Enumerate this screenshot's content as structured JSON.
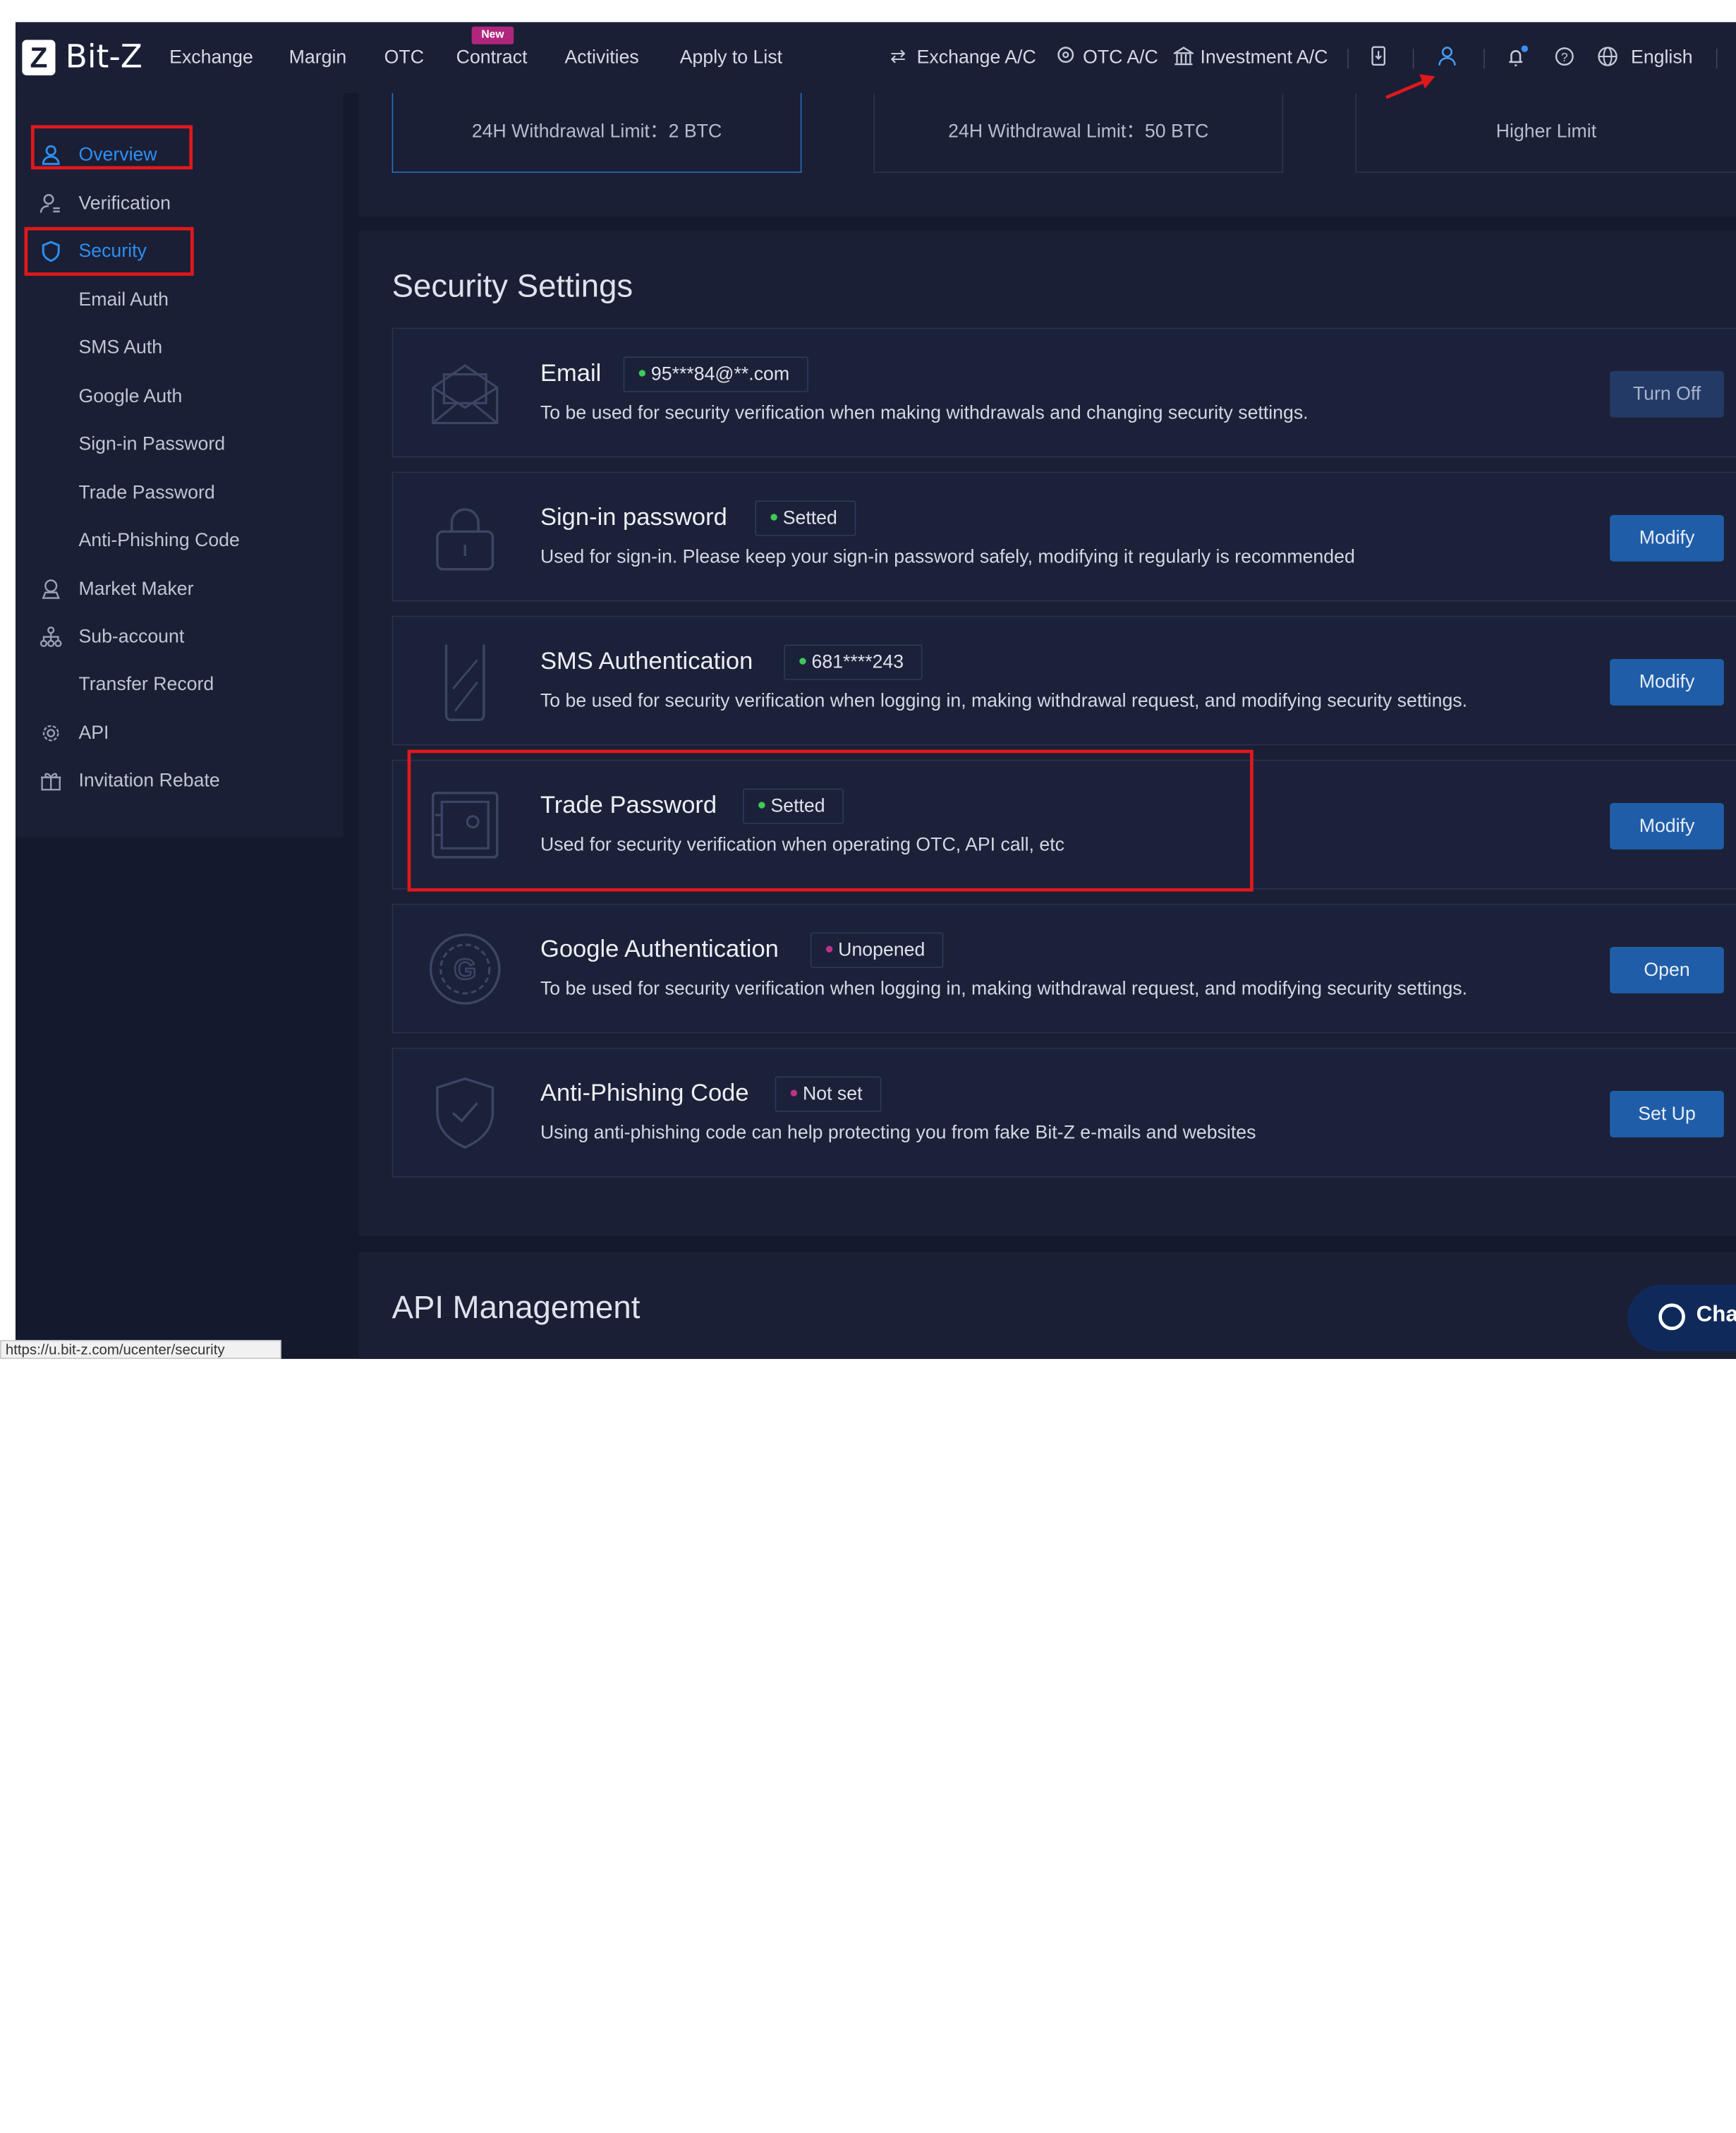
{
  "brand": {
    "logo_letter": "Z",
    "name": "Bit-Z"
  },
  "nav": {
    "items": [
      "Exchange",
      "Margin",
      "OTC",
      "Contract",
      "Activities",
      "Apply to List"
    ],
    "new_badge": "New"
  },
  "accounts": {
    "exchange": "Exchange A/C",
    "otc": "OTC A/C",
    "investment": "Investment A/C"
  },
  "top_right": {
    "language": "English"
  },
  "sidebar": {
    "items": [
      {
        "label": "Overview",
        "icon": "user-icon",
        "active": true
      },
      {
        "label": "Verification",
        "icon": "id-user-icon"
      },
      {
        "label": "Security",
        "icon": "shield-icon",
        "active": true
      },
      {
        "label": "Email Auth"
      },
      {
        "label": "SMS Auth"
      },
      {
        "label": "Google Auth"
      },
      {
        "label": "Sign-in Password"
      },
      {
        "label": "Trade Password"
      },
      {
        "label": "Anti-Phishing Code"
      },
      {
        "label": "Market Maker",
        "icon": "badge-icon"
      },
      {
        "label": "Sub-account",
        "icon": "hierarchy-icon"
      },
      {
        "label": "Transfer Record"
      },
      {
        "label": "API",
        "icon": "gear-icon"
      },
      {
        "label": "Invitation Rebate",
        "icon": "gift-icon"
      }
    ]
  },
  "limits": [
    "24H Withdrawal Limit：2 BTC",
    "24H Withdrawal Limit：50 BTC",
    "Higher Limit"
  ],
  "security": {
    "title": "Security Settings",
    "rows": [
      {
        "name": "Email",
        "tag": "95***84@**.com",
        "tag_color": "#3fc95a",
        "desc": "To be used for security verification when making withdrawals and changing security settings.",
        "button": "Turn Off"
      },
      {
        "name": "Sign-in password",
        "tag": "Setted",
        "tag_color": "#3fc95a",
        "desc": "Used for sign-in. Please keep your sign-in password safely, modifying it regularly is recommended",
        "button": "Modify"
      },
      {
        "name": "SMS Authentication",
        "tag": "681****243",
        "tag_color": "#3fc95a",
        "desc": "To be used for security verification when logging in, making withdrawal request, and modifying security settings.",
        "button": "Modify"
      },
      {
        "name": "Trade Password",
        "tag": "Setted",
        "tag_color": "#3fc95a",
        "desc": "Used for security verification when operating OTC, API call, etc",
        "button": "Modify"
      },
      {
        "name": "Google Authentication",
        "tag": "Unopened",
        "tag_color": "#c0308a",
        "desc": "To be used for security verification when logging in, making withdrawal request, and modifying security settings.",
        "button": "Open"
      },
      {
        "name": "Anti-Phishing Code",
        "tag": "Not set",
        "tag_color": "#c0308a",
        "desc": "Using anti-phishing code can help protecting you from fake Bit-Z e-mails and websites",
        "button": "Set Up"
      }
    ]
  },
  "api": {
    "title": "API Management"
  },
  "chat": {
    "label": "Cha"
  },
  "statusbar": {
    "url": "https://u.bit-z.com/ucenter/security"
  },
  "colors": {
    "accent": "#2e8ef0",
    "button": "#1f5da8",
    "highlight": "#e0181c",
    "bg": "#15192d",
    "panel": "#1a1f35"
  }
}
